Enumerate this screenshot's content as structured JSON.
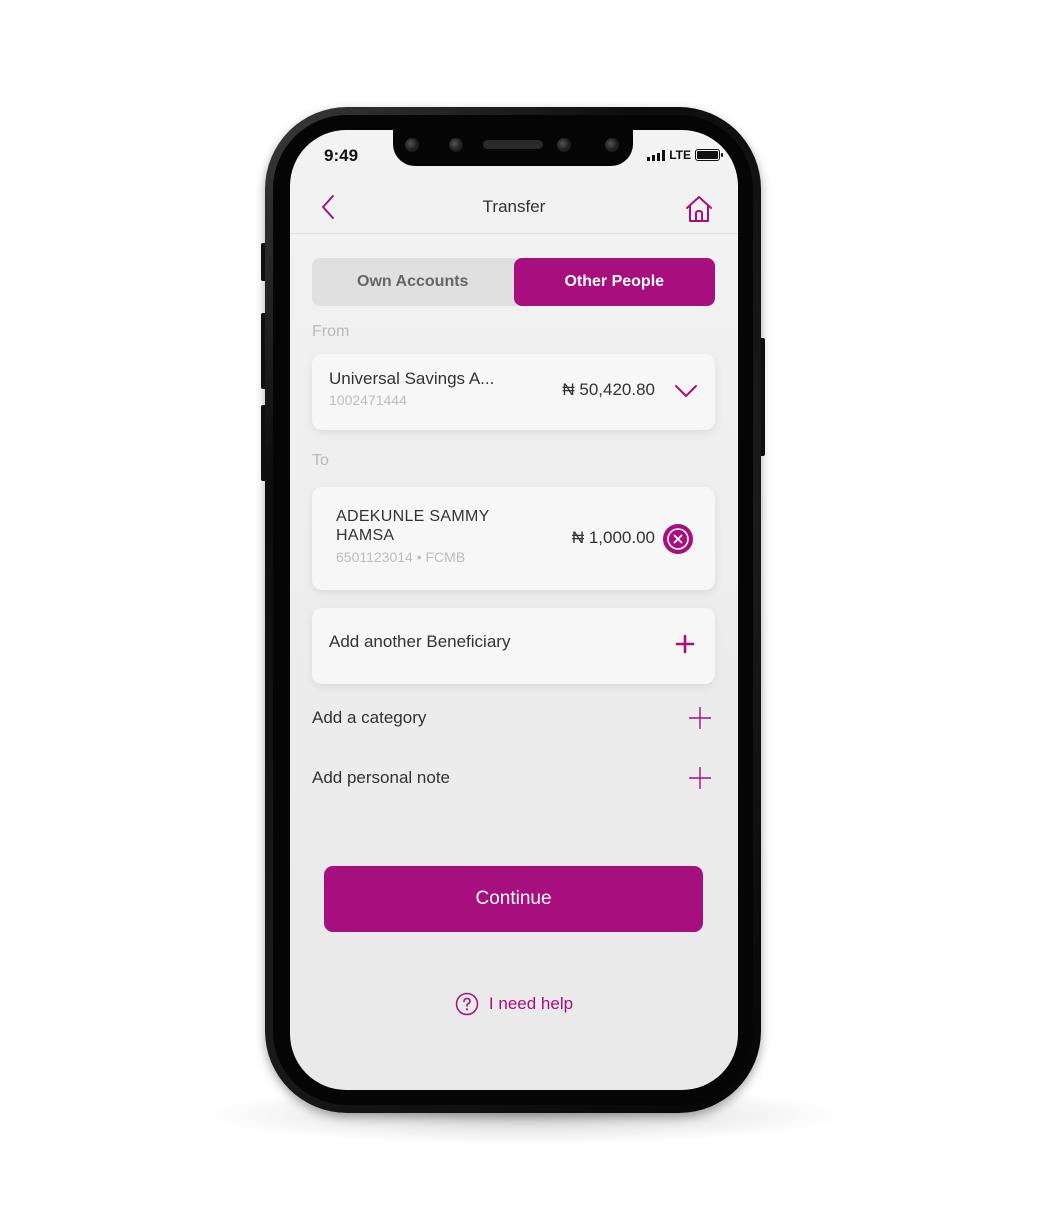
{
  "status_bar": {
    "time": "9:49",
    "network": "LTE"
  },
  "header": {
    "title": "Transfer"
  },
  "tabs": [
    {
      "label": "Own Accounts",
      "active": false
    },
    {
      "label": "Other People",
      "active": true
    }
  ],
  "from": {
    "label": "From",
    "account_name": "Universal Savings A...",
    "account_number": "1002471444",
    "balance": "₦ 50,420.80"
  },
  "to": {
    "label": "To",
    "beneficiary_name": "ADEKUNLE SAMMY HAMSA",
    "beneficiary_info": "6501123014 • FCMB",
    "amount": "₦ 1,000.00"
  },
  "add_beneficiary": "Add another Beneficiary",
  "add_category": "Add a category",
  "add_note": "Add personal note",
  "continue_label": "Continue",
  "help_label": "I need help",
  "colors": {
    "accent": "#a80f7e"
  },
  "icons": [
    "back-icon",
    "home-icon",
    "chevron-down-icon",
    "close-icon",
    "plus-icon",
    "help-icon"
  ]
}
